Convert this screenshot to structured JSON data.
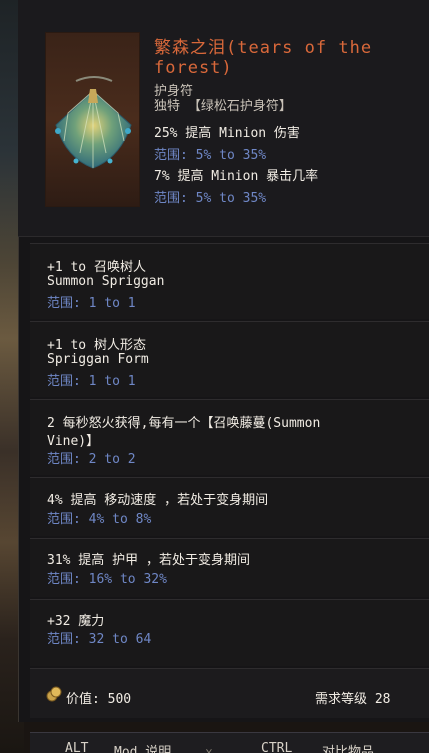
{
  "item": {
    "title": "繁森之泪(tears of the forest)",
    "type": "护身符",
    "rarity_line": "独特  【绿松石护身符】",
    "implicit_mods": [
      {
        "text": "25% 提高 Minion 伤害",
        "range": "范围: 5% to 35%"
      },
      {
        "text": "7% 提高 Minion 暴击几率",
        "range": "范围: 5% to 35%"
      }
    ]
  },
  "mods": [
    {
      "line1": "+1 to 召唤树人",
      "line2": "Summon Spriggan",
      "range": "范围: 1 to 1"
    },
    {
      "line1": "+1 to 树人形态",
      "line2": "Spriggan Form",
      "range": "范围: 1 to 1"
    },
    {
      "line1": "2 每秒怒火获得,每有一个【召唤藤蔓(Summon",
      "line2": "Vine)】",
      "range": "范围: 2 to 2"
    },
    {
      "line1": "4% 提高 移动速度 ，若处于变身期间",
      "range": "范围: 4% to 8%"
    },
    {
      "line1": "31% 提高 护甲 ，若处于变身期间",
      "range": "范围: 16% to 32%"
    },
    {
      "line1": "+32 魔力",
      "range": "范围: 32 to 64"
    }
  ],
  "footer": {
    "value_label": "价值: 500",
    "requirement_label": "需求等级  28"
  },
  "bottom_bar": {
    "alt_key": "ALT",
    "alt_action": "Mod 说明",
    "ctrl_key": "CTRL",
    "ctrl_action": "对比物品"
  },
  "icons": [
    "amulet-item-icon",
    "coin-icon"
  ],
  "colors": {
    "unique_title": "#d9683a",
    "range_text": "#6f87c6",
    "mod_text": "#f1ece4"
  }
}
